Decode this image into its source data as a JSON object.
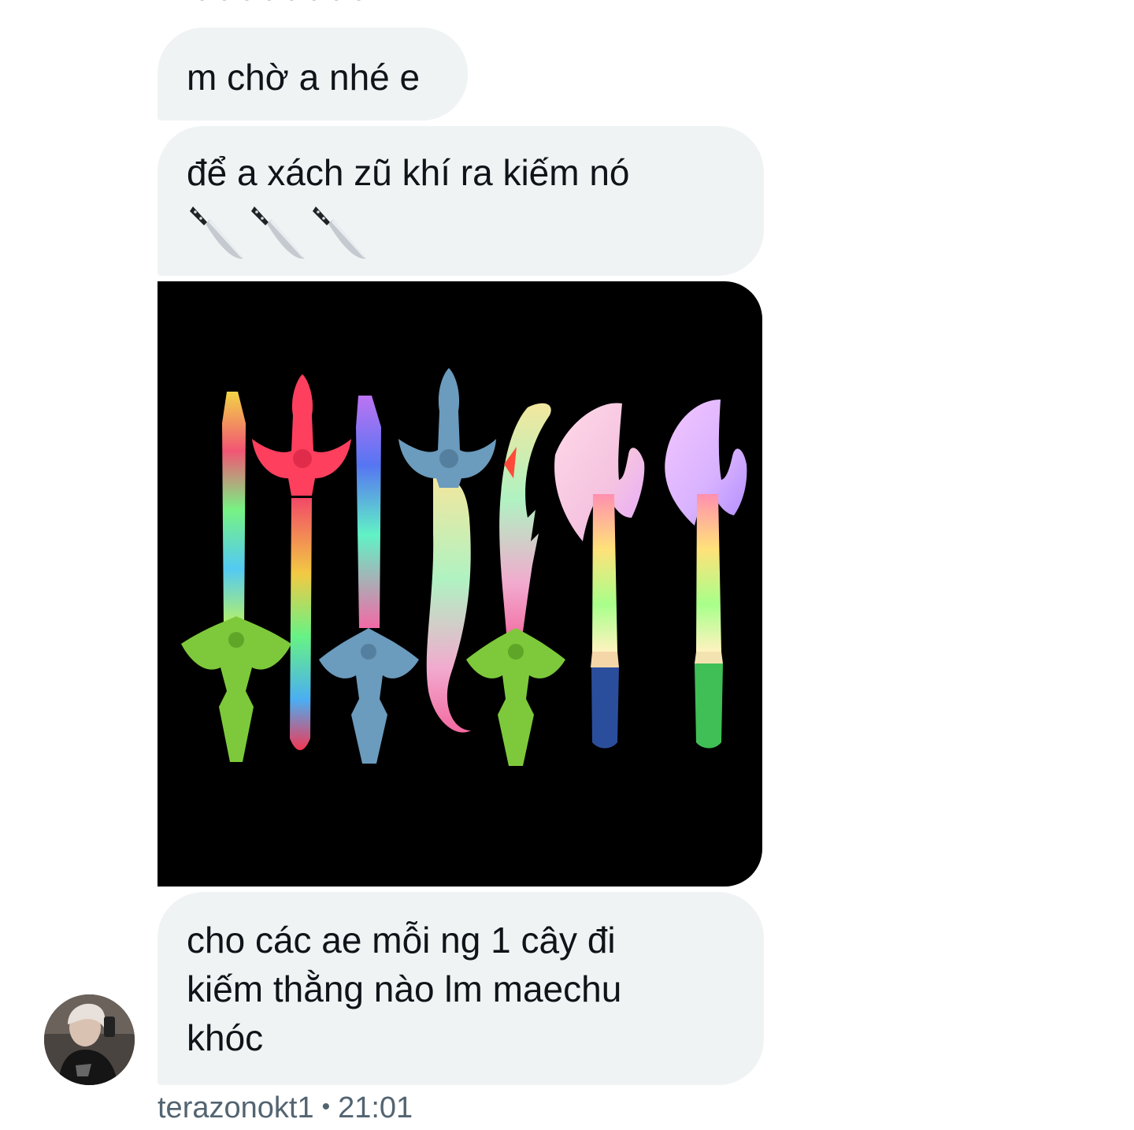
{
  "conversation": {
    "messages": [
      {
        "text": "m chờ a nhé e"
      },
      {
        "text": "để a xách zũ khí ra kiếm nó",
        "emoji": [
          "kitchen-knife",
          "kitchen-knife",
          "kitchen-knife"
        ]
      },
      {
        "image": "light-up-toy-swords-and-axes"
      },
      {
        "text": "cho các ae mỗi ng 1 cây đi\nkiếm thằng nào lm maechu\nkhóc"
      }
    ],
    "sender": {
      "username": "terazonokt1",
      "separator": "•",
      "time": "21:01"
    }
  },
  "colors": {
    "bubble": "#eff3f4",
    "text": "#0f1419",
    "meta": "#536471",
    "page": "#ffffff"
  },
  "icons": [
    "kitchen-knife-icon",
    "avatar-photo"
  ]
}
